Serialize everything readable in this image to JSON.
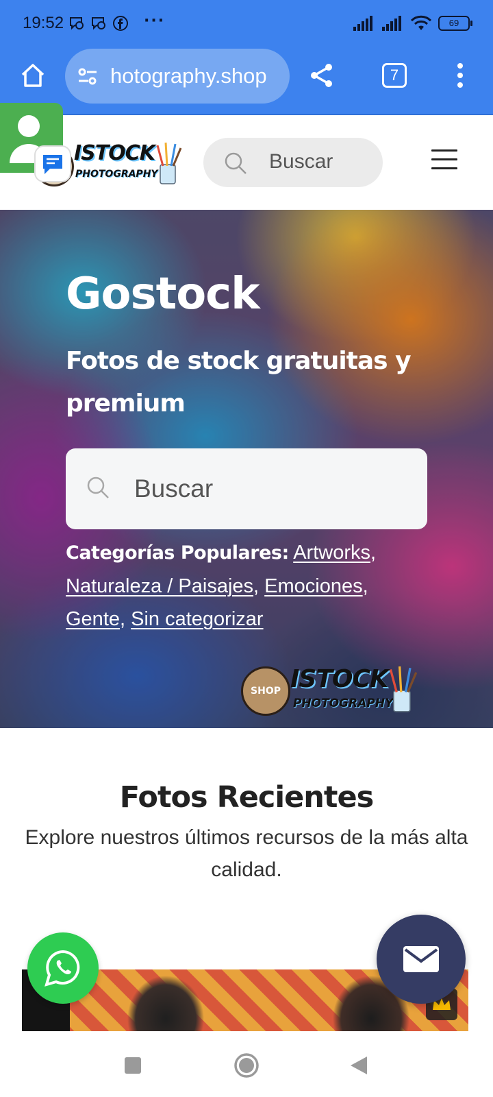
{
  "status_bar": {
    "time": "19:52",
    "more_dots": "···",
    "battery": "69"
  },
  "browser": {
    "url": "hotography.shop",
    "tab_count": "7"
  },
  "header": {
    "logo_line1": "ISTOCK",
    "logo_line2": "PHOTOGRAPHY",
    "search_placeholder": "Buscar"
  },
  "hero": {
    "title": "Gostock",
    "subtitle": "Fotos de stock gratuitas y premium",
    "search_placeholder": "Buscar",
    "categories_label": "Categorías Populares:",
    "categories": [
      "Artworks",
      "Naturaleza / Paisajes",
      "Emociones",
      "Gente",
      "Sin categorizar"
    ],
    "watermark_badge": "SHOP",
    "watermark_line1": "ISTOCK",
    "watermark_line2": "PHOTOGRAPHY"
  },
  "recent": {
    "title": "Fotos Recientes",
    "description": "Explore nuestros últimos recursos de la más alta calidad."
  },
  "colors": {
    "browser_blue": "#3d82ee",
    "whatsapp_green": "#2ecc52",
    "mail_fab": "#353c64"
  }
}
